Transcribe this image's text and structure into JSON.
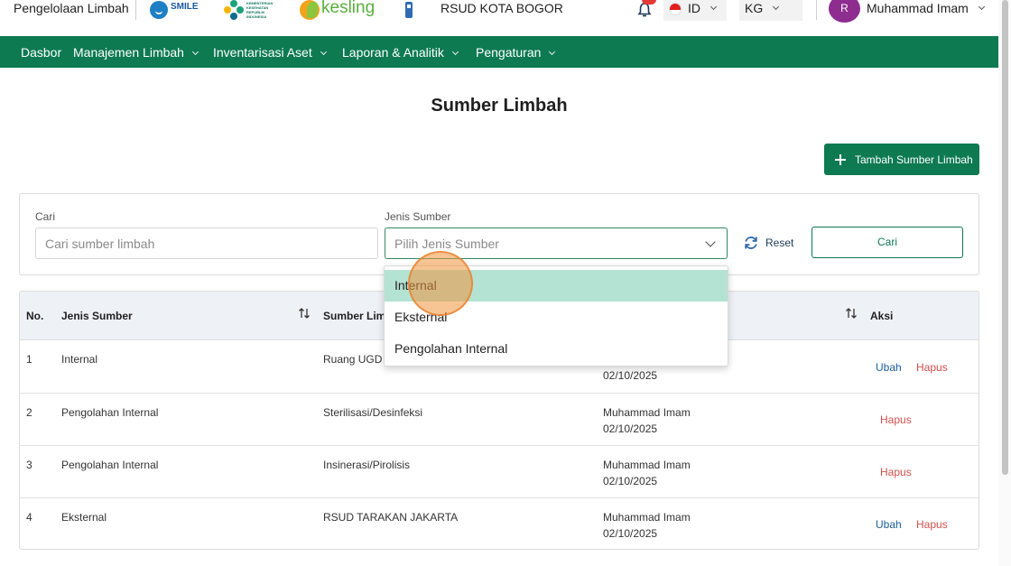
{
  "header": {
    "app_title": "Pengelolaan Limbah",
    "logos": {
      "smile": "SMILE",
      "kemenkes": "KEMENTERIAN KESEHATAN REPUBLIK INDONESIA",
      "kesling": "kesling"
    },
    "hospital_name": "RSUD KOTA BOGOR",
    "language": "ID",
    "unit": "KG",
    "user_initial": "R",
    "user_name": "Muhammad Imam"
  },
  "nav": {
    "items": [
      {
        "label": "Dasbor",
        "has_dropdown": false
      },
      {
        "label": "Manajemen Limbah",
        "has_dropdown": true
      },
      {
        "label": "Inventarisasi Aset",
        "has_dropdown": true
      },
      {
        "label": "Laporan & Analitik",
        "has_dropdown": true
      },
      {
        "label": "Pengaturan",
        "has_dropdown": true
      }
    ]
  },
  "page": {
    "title": "Sumber Limbah",
    "add_button": "Tambah Sumber Limbah"
  },
  "filters": {
    "search_label": "Cari",
    "search_placeholder": "Cari sumber limbah",
    "type_label": "Jenis Sumber",
    "type_placeholder": "Pilih Jenis Sumber",
    "reset_label": "Reset",
    "search_button": "Cari",
    "type_options": [
      "Internal",
      "Eksternal",
      "Pengolahan Internal"
    ],
    "highlighted_option": "Internal"
  },
  "table": {
    "columns": [
      "No.",
      "Jenis Sumber",
      "Sumber Limb",
      "Aksi"
    ],
    "rows": [
      {
        "no": "1",
        "jenis": "Internal",
        "sumber": "Ruang UGD",
        "user": "",
        "date": "02/10/2025",
        "actions": [
          "Ubah",
          "Hapus"
        ]
      },
      {
        "no": "2",
        "jenis": "Pengolahan Internal",
        "sumber": "Sterilisasi/Desinfeksi",
        "user": "Muhammad Imam",
        "date": "02/10/2025",
        "actions": [
          "Hapus"
        ]
      },
      {
        "no": "3",
        "jenis": "Pengolahan Internal",
        "sumber": "Insinerasi/Pirolisis",
        "user": "Muhammad Imam",
        "date": "02/10/2025",
        "actions": [
          "Hapus"
        ]
      },
      {
        "no": "4",
        "jenis": "Eksternal",
        "sumber": "RSUD TARAKAN JAKARTA",
        "user": "Muhammad Imam",
        "date": "02/10/2025",
        "actions": [
          "Ubah",
          "Hapus"
        ]
      }
    ]
  },
  "colors": {
    "brand_green": "#0d7a52",
    "highlight_option": "#b4e3d4",
    "link_blue": "#1c5f9c",
    "delete_red": "#d0504d",
    "avatar": "#8e2c8f"
  }
}
